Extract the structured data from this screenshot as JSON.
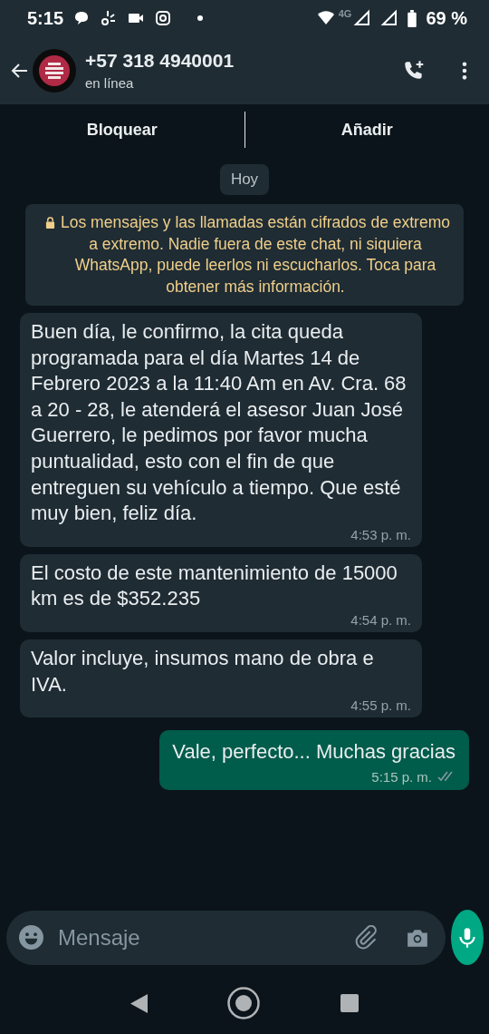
{
  "status_bar": {
    "time": "5:15",
    "network": "4G",
    "battery": "69 %"
  },
  "header": {
    "title": "+57 318 4940001",
    "subtitle": "en línea"
  },
  "actions": [
    {
      "label": "Bloquear"
    },
    {
      "label": "Añadir"
    }
  ],
  "date_chip": "Hoy",
  "encryption_notice": "Los mensajes y las llamadas están cifrados de extremo a extremo. Nadie fuera de este chat, ni siquiera WhatsApp, puede leerlos ni escucharlos. Toca para obtener más información.",
  "messages": [
    {
      "kind": "incoming",
      "text": "Buen día, le confirmo, la cita queda programada para el día Martes 14 de Febrero 2023 a la 11:40 Am en Av. Cra. 68 a 20 - 28, le atenderá el asesor Juan José Guerrero, le pedimos por favor mucha puntualidad, esto con el fin de que entreguen su vehículo a tiempo. Que esté muy bien, feliz día.",
      "time": "4:53 p. m."
    },
    {
      "kind": "incoming",
      "text": "El costo de este mantenimiento de 15000 km es de $352.235",
      "time": "4:54 p. m."
    },
    {
      "kind": "incoming",
      "text": "Valor incluye, insumos mano de obra e IVA.",
      "time": "4:55 p. m."
    },
    {
      "kind": "outgoing",
      "text": "Vale, perfecto... Muchas gracias",
      "time": "5:15 p. m.",
      "read": false
    }
  ],
  "composer": {
    "placeholder": "Mensaje"
  }
}
